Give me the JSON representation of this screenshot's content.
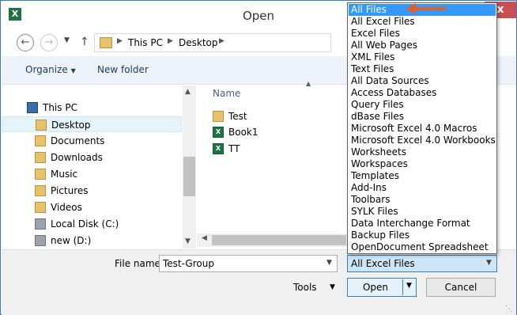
{
  "window": {
    "title": "Open",
    "app_icon_label": "X",
    "close_label": "x"
  },
  "address": {
    "crumbs": [
      "This PC",
      "Desktop"
    ]
  },
  "toolbar": {
    "organize_label": "Organize",
    "new_folder_label": "New folder"
  },
  "nav_pane": {
    "items": [
      {
        "label": "This PC",
        "icon": "computer-icon",
        "selected": false
      },
      {
        "label": "Desktop",
        "icon": "folder-icon",
        "selected": true
      },
      {
        "label": "Documents",
        "icon": "folder-icon",
        "selected": false
      },
      {
        "label": "Downloads",
        "icon": "folder-icon",
        "selected": false
      },
      {
        "label": "Music",
        "icon": "music-folder-icon",
        "selected": false
      },
      {
        "label": "Pictures",
        "icon": "folder-icon",
        "selected": false
      },
      {
        "label": "Videos",
        "icon": "folder-icon",
        "selected": false
      },
      {
        "label": "Local Disk (C:)",
        "icon": "disk-icon",
        "selected": false
      },
      {
        "label": "new (D:)",
        "icon": "disk-icon",
        "selected": false
      }
    ]
  },
  "file_pane": {
    "column_header": "Name",
    "items": [
      {
        "label": "Test",
        "icon": "folder-icon"
      },
      {
        "label": "Book1",
        "icon": "excel-file-icon"
      },
      {
        "label": "TT",
        "icon": "excel-file-icon"
      }
    ]
  },
  "bottom": {
    "file_name_label": "File name:",
    "file_name_value": "Test-Group",
    "filter_value": "All Excel Files",
    "tools_label": "Tools",
    "open_label": "Open",
    "cancel_label": "Cancel"
  },
  "file_type_dropdown": {
    "options": [
      "All Files",
      "All Excel Files",
      "Excel Files",
      "All Web Pages",
      "XML Files",
      "Text Files",
      "All Data Sources",
      "Access Databases",
      "Query Files",
      "dBase Files",
      "Microsoft Excel 4.0 Macros",
      "Microsoft Excel 4.0 Workbooks",
      "Worksheets",
      "Workspaces",
      "Templates",
      "Add-Ins",
      "Toolbars",
      "SYLK Files",
      "Data Interchange Format",
      "Backup Files",
      "OpenDocument Spreadsheet"
    ],
    "highlighted_index": 0,
    "highlight_color": "#3399ff"
  },
  "annotation": {
    "arrow_color": "#e0602a"
  }
}
